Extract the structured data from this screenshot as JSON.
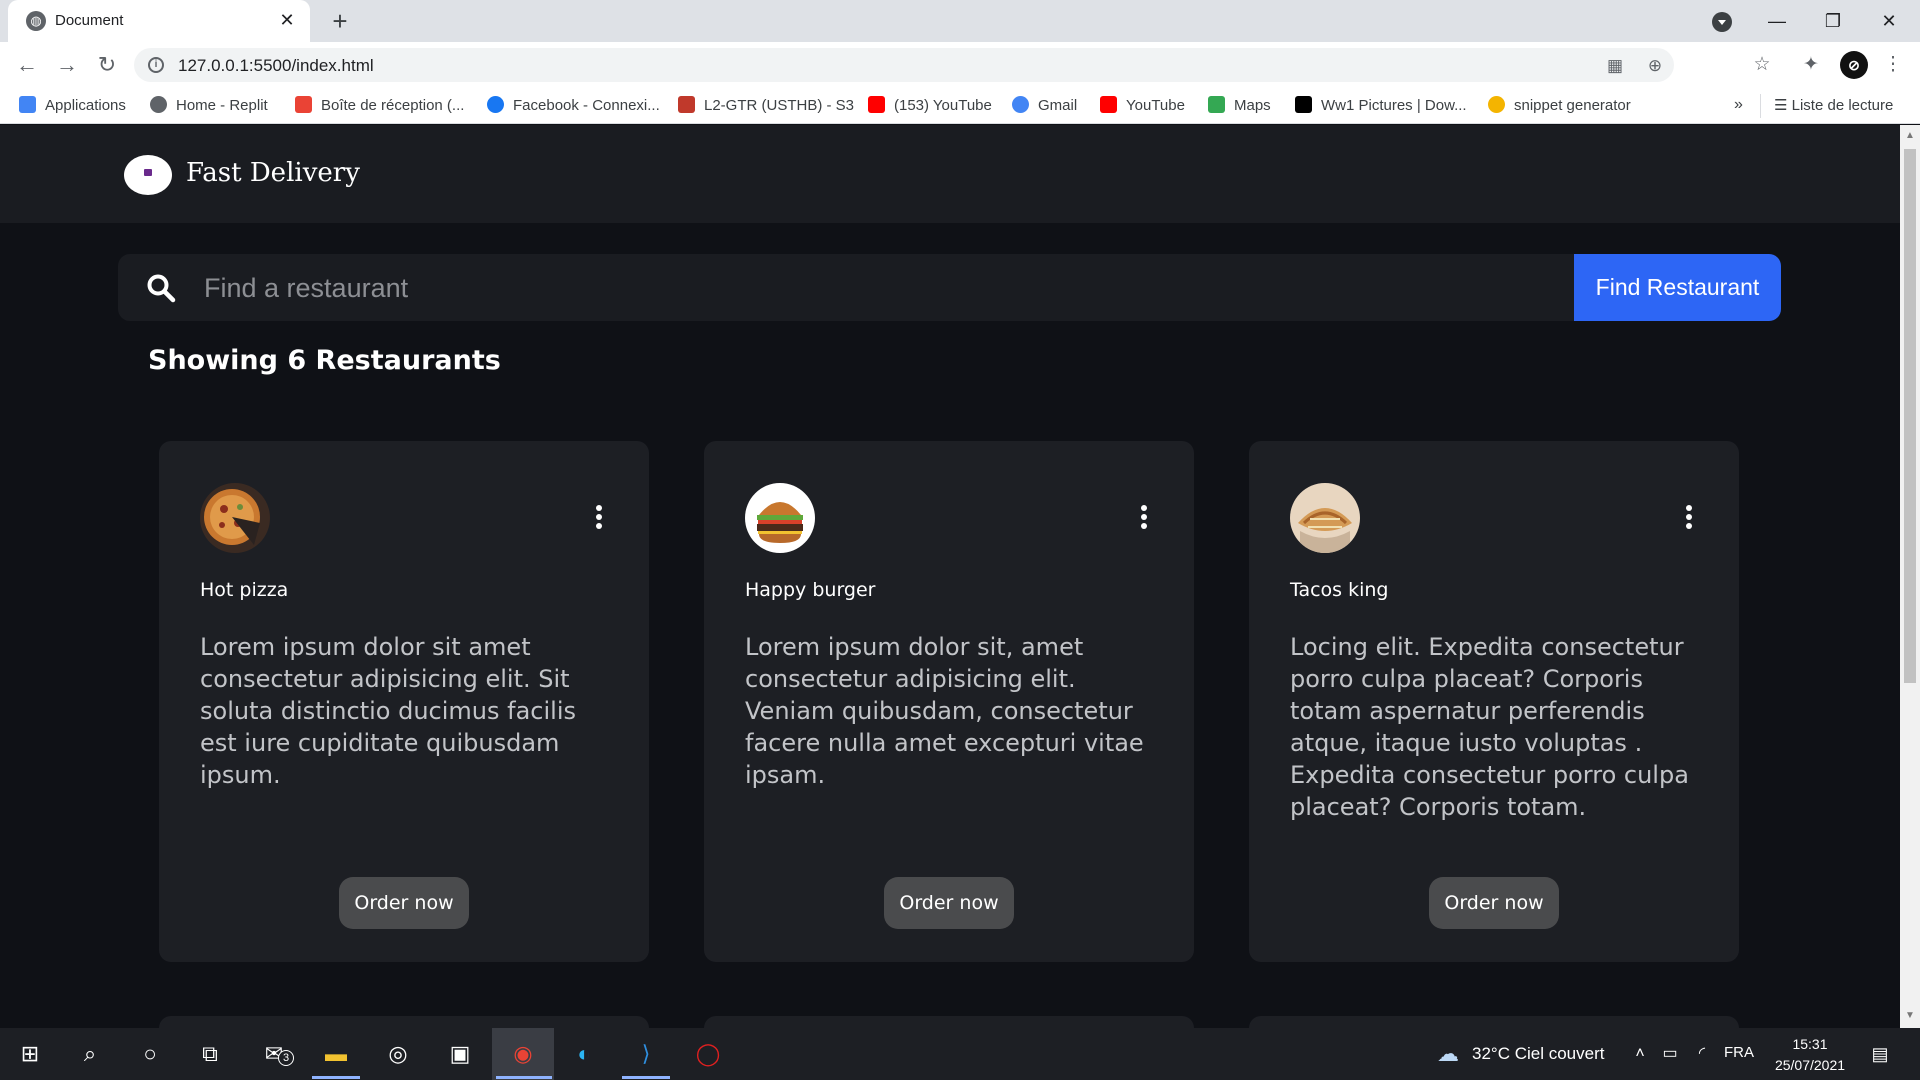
{
  "browser": {
    "tab_title": "Document",
    "url": "127.0.0.1:5500/index.html",
    "bookmarks": [
      {
        "label": "Applications",
        "icon": "apps-grid-icon",
        "color": "#4285f4"
      },
      {
        "label": "Home - Replit",
        "icon": "replit-icon",
        "color": "#5f6368"
      },
      {
        "label": "Boîte de réception (...",
        "icon": "gmail-icon",
        "color": "#ea4335"
      },
      {
        "label": "Facebook - Connexi...",
        "icon": "facebook-icon",
        "color": "#1877f2"
      },
      {
        "label": "L2-GTR (USTHB) - S3",
        "icon": "usthb-icon",
        "color": "#c0392b"
      },
      {
        "label": "(153) YouTube",
        "icon": "youtube-icon",
        "color": "#ff0000"
      },
      {
        "label": "Gmail",
        "icon": "google-icon",
        "color": "#4285f4"
      },
      {
        "label": "YouTube",
        "icon": "youtube-icon",
        "color": "#ff0000"
      },
      {
        "label": "Maps",
        "icon": "maps-icon",
        "color": "#34a853"
      },
      {
        "label": "Ww1 Pictures | Dow...",
        "icon": "site-icon",
        "color": "#000000"
      },
      {
        "label": "snippet generator",
        "icon": "star-icon",
        "color": "#f4b400"
      }
    ],
    "more_label": "»",
    "reading_list_label": "Liste de lecture"
  },
  "site": {
    "brand": "Fast Delivery",
    "search_placeholder": "Find a restaurant",
    "find_button": "Find Restaurant",
    "showing_label": "Showing 6 Restaurants",
    "accent": "#2d66f5"
  },
  "restaurants": [
    {
      "name": "Hot pizza",
      "image": "pizza-image",
      "description": "Lorem ipsum dolor sit amet consectetur adipisicing elit. Sit soluta distinctio ducimus facilis est iure cupiditate quibusdam ipsum.",
      "order_label": "Order now"
    },
    {
      "name": "Happy burger",
      "image": "burger-image",
      "description": "Lorem ipsum dolor sit, amet consectetur adipisicing elit. Veniam quibusdam, consectetur facere nulla amet excepturi vitae ipsam.",
      "order_label": "Order now"
    },
    {
      "name": "Tacos king",
      "image": "tacos-image",
      "description": "Locing elit. Expedita consectetur porro culpa placeat? Corporis totam aspernatur perferendis atque, itaque iusto voluptas . Expedita consectetur porro culpa placeat? Corporis totam.",
      "order_label": "Order now"
    }
  ],
  "taskbar": {
    "mail_badge": "3",
    "weather": "32°C  Ciel couvert",
    "language": "FRA",
    "time": "15:31",
    "date": "25/07/2021"
  }
}
